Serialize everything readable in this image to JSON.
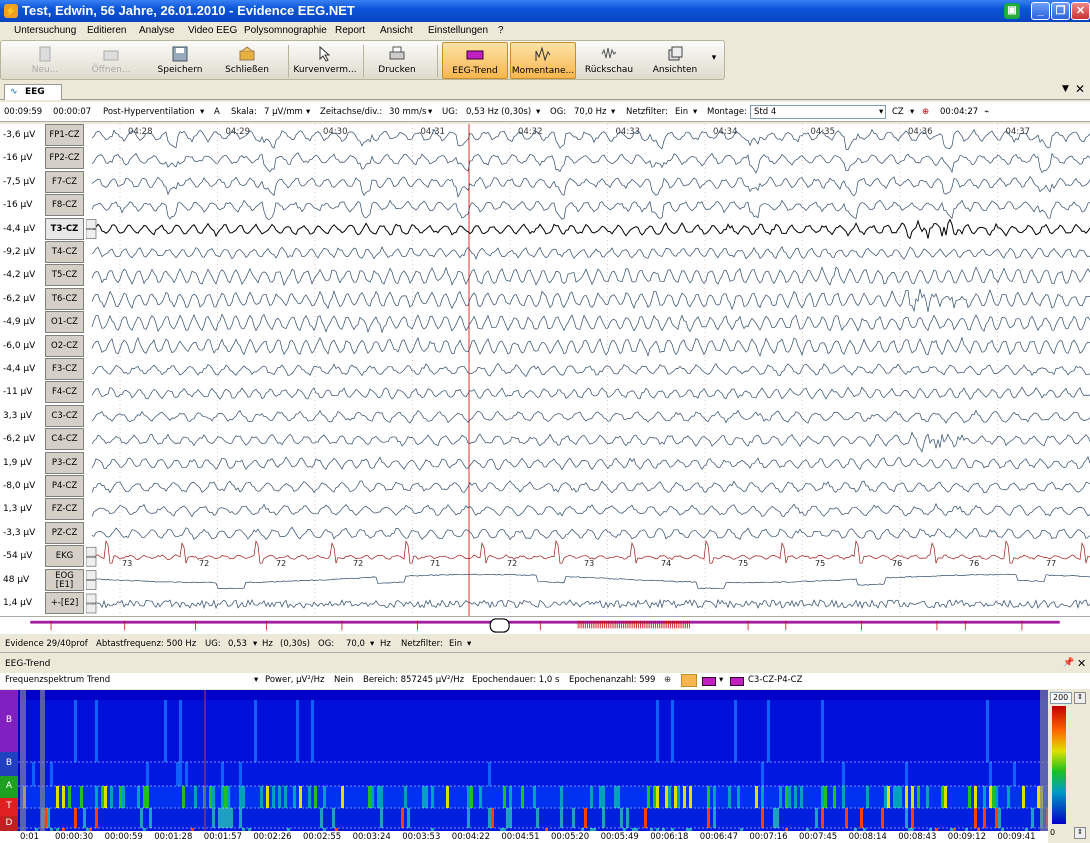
{
  "window": {
    "title": "Test, Edwin, 56 Jahre, 26.01.2010 - Evidence EEG.NET"
  },
  "menu": [
    "Untersuchung",
    "Editieren",
    "Analyse",
    "Video EEG",
    "Polysomnographie",
    "Report",
    "Ansicht",
    "Einstellungen",
    "?"
  ],
  "toolbar": [
    {
      "label": "Neu...",
      "icon": "new-icon",
      "enabled": false
    },
    {
      "label": "Öffnen...",
      "icon": "open-icon",
      "enabled": false
    },
    {
      "label": "Speichern",
      "icon": "save-icon",
      "enabled": true
    },
    {
      "label": "Schließen",
      "icon": "close-doc-icon",
      "enabled": true
    },
    {
      "label": "Kurvenverm...",
      "icon": "cursor-icon",
      "enabled": true
    },
    {
      "label": "Drucken",
      "icon": "print-icon",
      "enabled": true
    },
    {
      "label": "EEG-Trend",
      "icon": "trend-icon",
      "enabled": true,
      "active": true
    },
    {
      "label": "Momentane...",
      "icon": "momentary-icon",
      "enabled": true,
      "active": true
    },
    {
      "label": "Rückschau",
      "icon": "review-icon",
      "enabled": true
    },
    {
      "label": "Ansichten",
      "icon": "views-icon",
      "enabled": true
    }
  ],
  "tab": {
    "label": "EEG"
  },
  "status": {
    "time1": "00:09:59",
    "time2": "00:00:07",
    "phase": "Post-Hyperventilation",
    "a": "A",
    "skala_label": "Skala:",
    "skala": "7 µV/mm",
    "zeit_label": "Zeitachse/div.:",
    "zeit": "30 mm/s",
    "ug_label": "UG:",
    "ug": "0,53 Hz (0,30s)",
    "og_label": "OG:",
    "og": "70,0 Hz",
    "netz_label": "Netzfilter:",
    "netz": "Ein",
    "montage_label": "Montage:",
    "montage": "Std 4",
    "ref": "CZ",
    "time3": "00:04:27"
  },
  "time_marks": [
    "04:28",
    "04:29",
    "04:30",
    "04:31",
    "04:32",
    "04:33",
    "04:34",
    "04:35",
    "04:36",
    "04:37"
  ],
  "channels": [
    {
      "value": "-3,6 µV",
      "name": "FP1-CZ"
    },
    {
      "value": "-16 µV",
      "name": "FP2-CZ"
    },
    {
      "value": "-7,5 µV",
      "name": "F7-CZ"
    },
    {
      "value": "-16 µV",
      "name": "F8-CZ"
    },
    {
      "value": "-4,4 µV",
      "name": "T3-CZ"
    },
    {
      "value": "-9,2 µV",
      "name": "T4-CZ"
    },
    {
      "value": "-4,2 µV",
      "name": "T5-CZ"
    },
    {
      "value": "-6,2 µV",
      "name": "T6-CZ"
    },
    {
      "value": "-4,9 µV",
      "name": "O1-CZ"
    },
    {
      "value": "-6,0 µV",
      "name": "O2-CZ"
    },
    {
      "value": "-4,4 µV",
      "name": "F3-CZ"
    },
    {
      "value": "-11 µV",
      "name": "F4-CZ"
    },
    {
      "value": "3,3 µV",
      "name": "C3-CZ"
    },
    {
      "value": "-6,2 µV",
      "name": "C4-CZ"
    },
    {
      "value": "1,9 µV",
      "name": "P3-CZ"
    },
    {
      "value": "-8,0 µV",
      "name": "P4-CZ"
    },
    {
      "value": "1,3 µV",
      "name": "FZ-CZ"
    },
    {
      "value": "-3,3 µV",
      "name": "PZ-CZ"
    },
    {
      "value": "-54 µV",
      "name": "EKG"
    },
    {
      "value": "48 µV",
      "name": "EOG [E1]"
    },
    {
      "value": "1,4 µV",
      "name": "+-[E2]"
    }
  ],
  "ekg_beats": [
    "73",
    "72",
    "72",
    "72",
    "71",
    "72",
    "73",
    "74",
    "75",
    "75",
    "76",
    "76",
    "77"
  ],
  "info": {
    "version": "Evidence 29/40prof",
    "abtast": "Abtastfrequenz: 500 Hz",
    "ug_label": "UG:",
    "ug": "0,53",
    "ug_unit": "Hz",
    "ug_tc": "(0,30s)",
    "og_label": "OG:",
    "og": "70,0",
    "og_unit": "Hz",
    "netz_label": "Netzfilter:",
    "netz": "Ein"
  },
  "trend": {
    "title": "EEG-Trend",
    "mode": "Frequenzspektrum Trend",
    "power": "Power, µV²/Hz",
    "nein": "Nein",
    "bereich": "Bereich: 857245 µV²/Hz",
    "epochendauer": "Epochendauer: 1,0 s",
    "epochenanzahl": "Epochenanzahl: 599",
    "channel": "C3-CZ-P4-CZ",
    "scale_max": "200",
    "scale_min": "0",
    "bands": [
      "B",
      "B",
      "A",
      "T",
      "D"
    ],
    "times": [
      "0:01",
      "00:00:30",
      "00:00:59",
      "00:01:28",
      "00:01:57",
      "00:02:26",
      "00:02:55",
      "00:03:24",
      "00:03:53",
      "00:04:22",
      "00:04:51",
      "00:05:20",
      "00:05:49",
      "00:06:18",
      "00:06:47",
      "00:07:16",
      "00:07:45",
      "00:08:14",
      "00:08:43",
      "00:09:12",
      "00:09:41"
    ]
  }
}
